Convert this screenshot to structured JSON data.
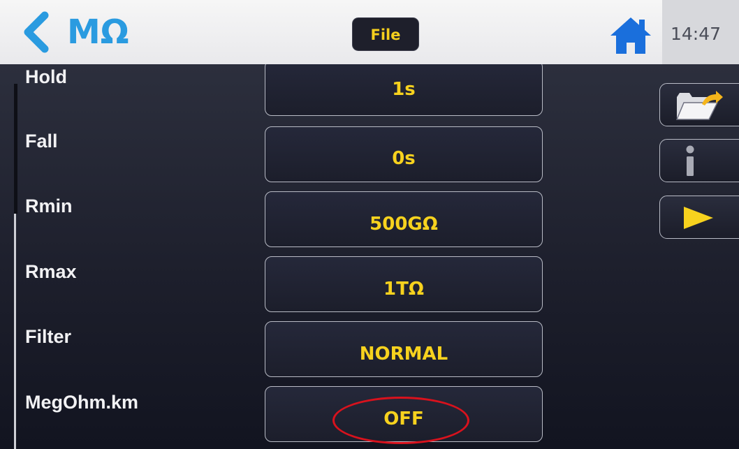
{
  "header": {
    "back_icon": "chevron-left-icon",
    "title": "MΩ",
    "file_label": "File",
    "home_icon": "home-icon",
    "time": "14:47"
  },
  "colors": {
    "accent_blue": "#2a9be0",
    "value_yellow": "#f7d21e",
    "highlight_red": "#d8121d"
  },
  "settings": [
    {
      "label": "Hold",
      "value": "1s"
    },
    {
      "label": "Fall",
      "value": "0s"
    },
    {
      "label": "Rmin",
      "value": "500GΩ"
    },
    {
      "label": "Rmax",
      "value": "1TΩ"
    },
    {
      "label": "Filter",
      "value": "NORMAL"
    },
    {
      "label": "MegOhm.km",
      "value": "OFF"
    }
  ],
  "side_buttons": [
    {
      "icon": "folder-open-icon"
    },
    {
      "icon": "info-icon"
    },
    {
      "icon": "play-icon"
    }
  ]
}
